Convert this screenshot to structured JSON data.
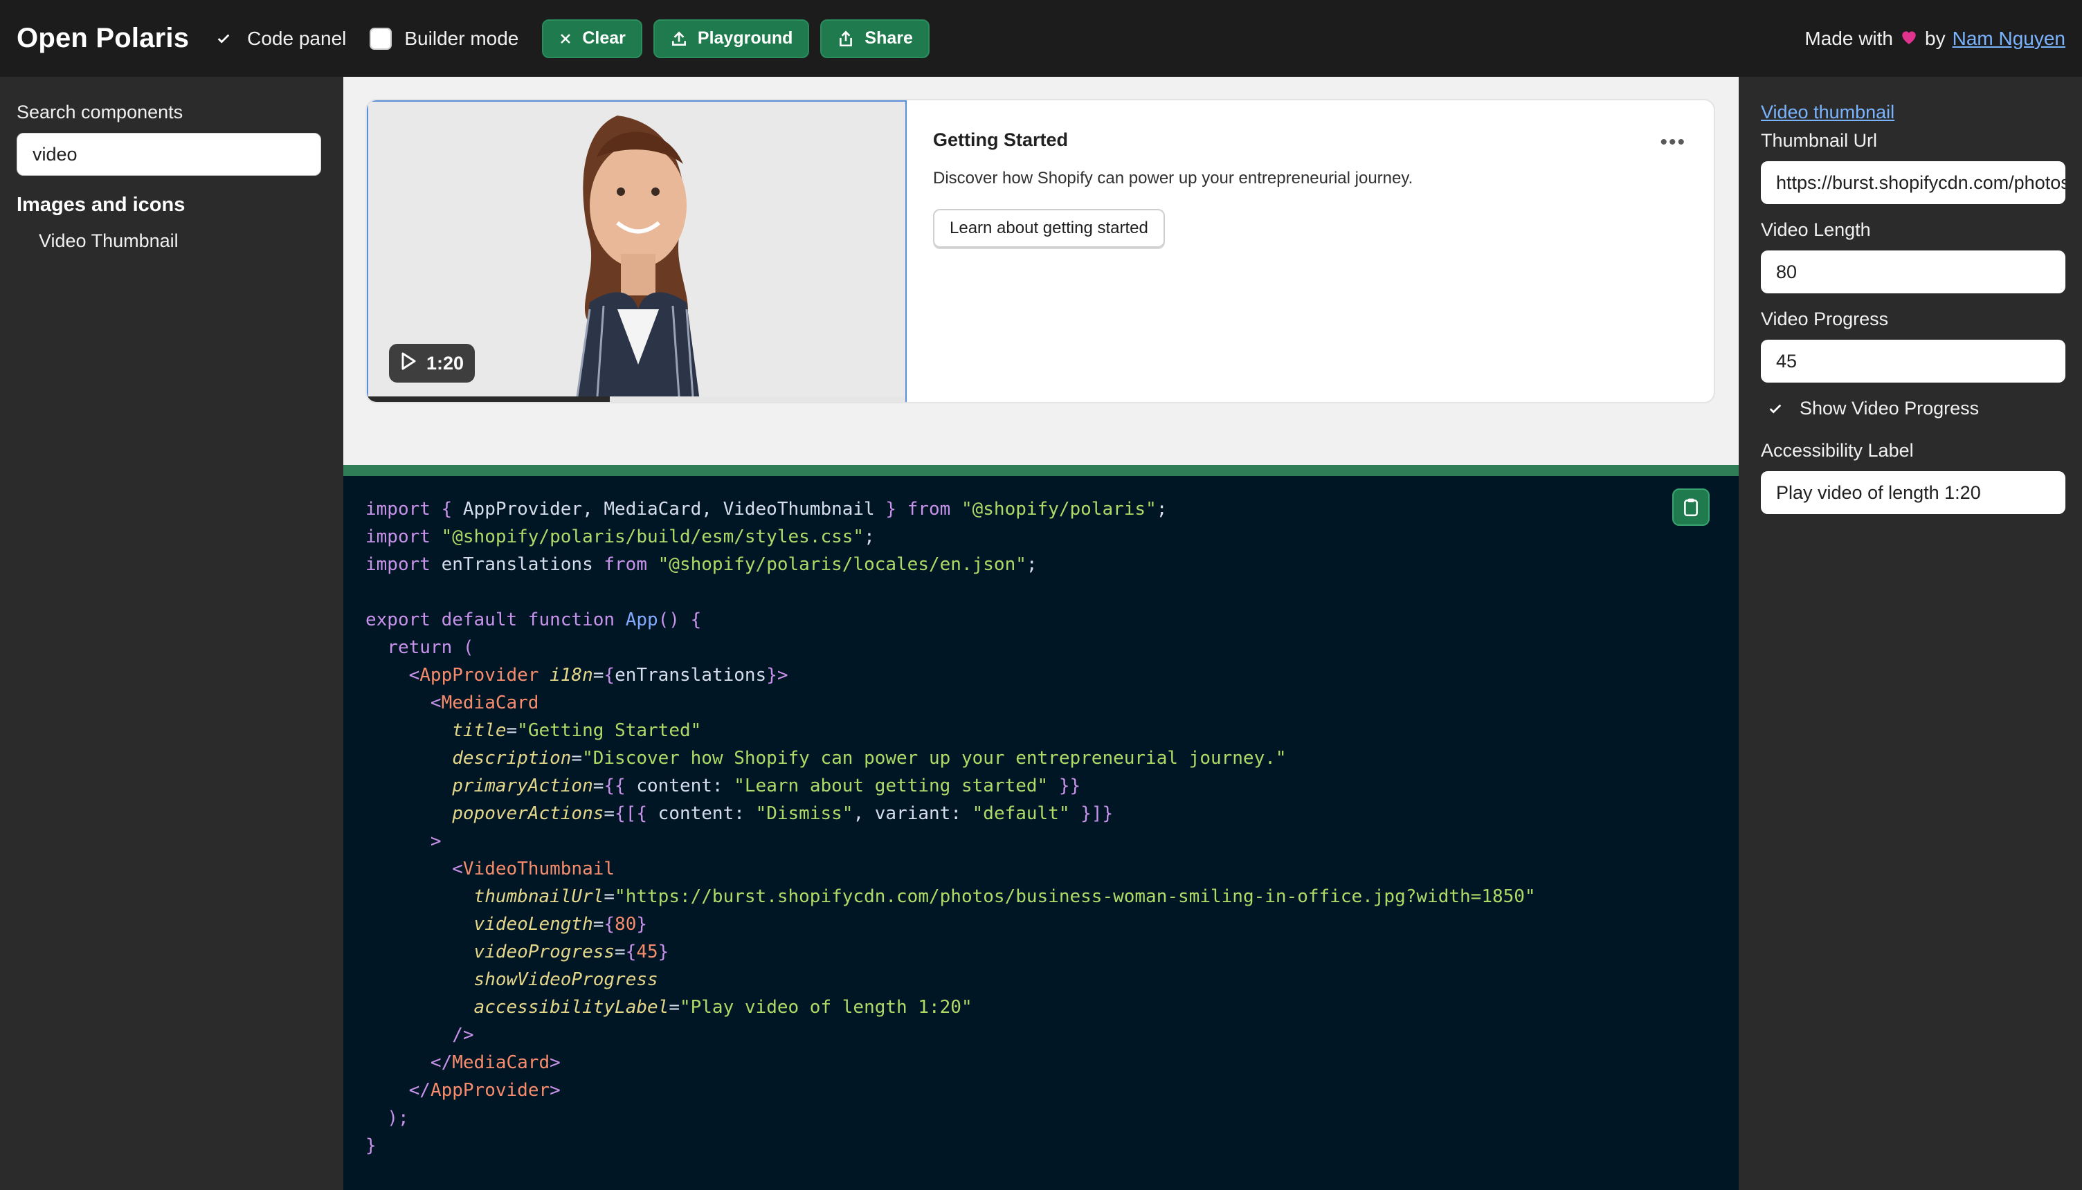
{
  "header": {
    "brand": "Open Polaris",
    "code_panel_label": "Code panel",
    "builder_mode_label": "Builder mode",
    "clear_label": "Clear",
    "playground_label": "Playground",
    "share_label": "Share",
    "made_with_prefix": "Made with",
    "made_with_by": "by",
    "author": "Nam Nguyen"
  },
  "left": {
    "search_label": "Search components",
    "search_value": "video",
    "group_title": "Images and icons",
    "items": [
      "Video Thumbnail"
    ]
  },
  "preview": {
    "play_time": "1:20",
    "progress": 45,
    "card_title": "Getting Started",
    "card_description": "Discover how Shopify can power up your entrepreneurial journey.",
    "card_action": "Learn about getting started",
    "more_icon": "•••"
  },
  "right": {
    "link": "Video thumbnail",
    "thumbnail_url_label": "Thumbnail Url",
    "thumbnail_url_value": "https://burst.shopifycdn.com/photos/business-woman-smiling-in-office.jpg?width=1850",
    "video_length_label": "Video Length",
    "video_length_value": "80",
    "video_progress_label": "Video Progress",
    "video_progress_value": "45",
    "show_progress_label": "Show Video Progress",
    "accessibility_label": "Accessibility Label",
    "accessibility_value": "Play video of length 1:20"
  },
  "colors": {
    "accent_green": "#1f7a4d",
    "link_blue": "#7ab4ff",
    "code_bg": "#001624"
  }
}
